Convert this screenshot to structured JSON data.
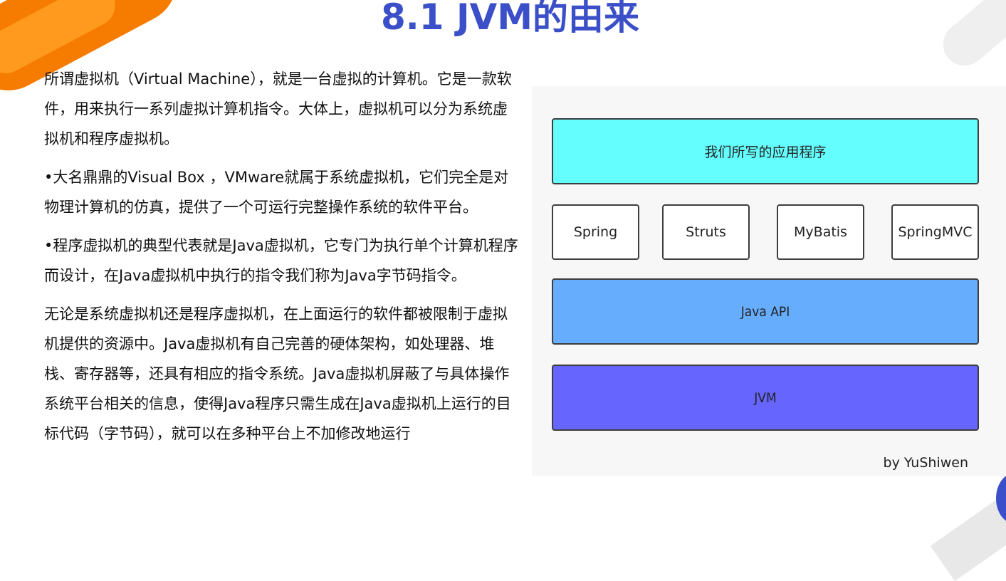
{
  "title": "8.1 JVM的由来",
  "paragraphs": [
    "所谓虚拟机（Virtual Machine），就是一台虚拟的计算机。它是一款软件，用来执行一系列虚拟计算机指令。大体上，虚拟机可以分为系统虚拟机和程序虚拟机。",
    "•大名鼎鼎的Visual Box ，VMware就属于系统虚拟机，它们完全是对物理计算机的仿真，提供了一个可运行完整操作系统的软件平台。",
    "•程序虚拟机的典型代表就是Java虚拟机，它专门为执行单个计算机程序而设计，在Java虚拟机中执行的指令我们称为Java字节码指令。",
    "无论是系统虚拟机还是程序虚拟机，在上面运行的软件都被限制于虚拟机提供的资源中。Java虚拟机有自己完善的硬体架构，如处理器、堆栈、寄存器等，还具有相应的指令系统。Java虚拟机屏蔽了与具体操作系统平台相关的信息，使得Java程序只需生成在Java虚拟机上运行的目标代码（字节码），就可以在多种平台上不加修改地运行"
  ],
  "diagram": {
    "app_layer": "我们所写的应用程序",
    "frameworks": [
      "Spring",
      "Struts",
      "MyBatis",
      "SpringMVC"
    ],
    "api_layer": "Java API",
    "jvm_layer": "JVM",
    "author": "by YuShiwen",
    "colors": {
      "app": "#65fefe",
      "api": "#66adfe",
      "jvm": "#6665fe"
    }
  },
  "colors": {
    "title": "#3b4fc8",
    "accent_orange": "#f57c00"
  }
}
